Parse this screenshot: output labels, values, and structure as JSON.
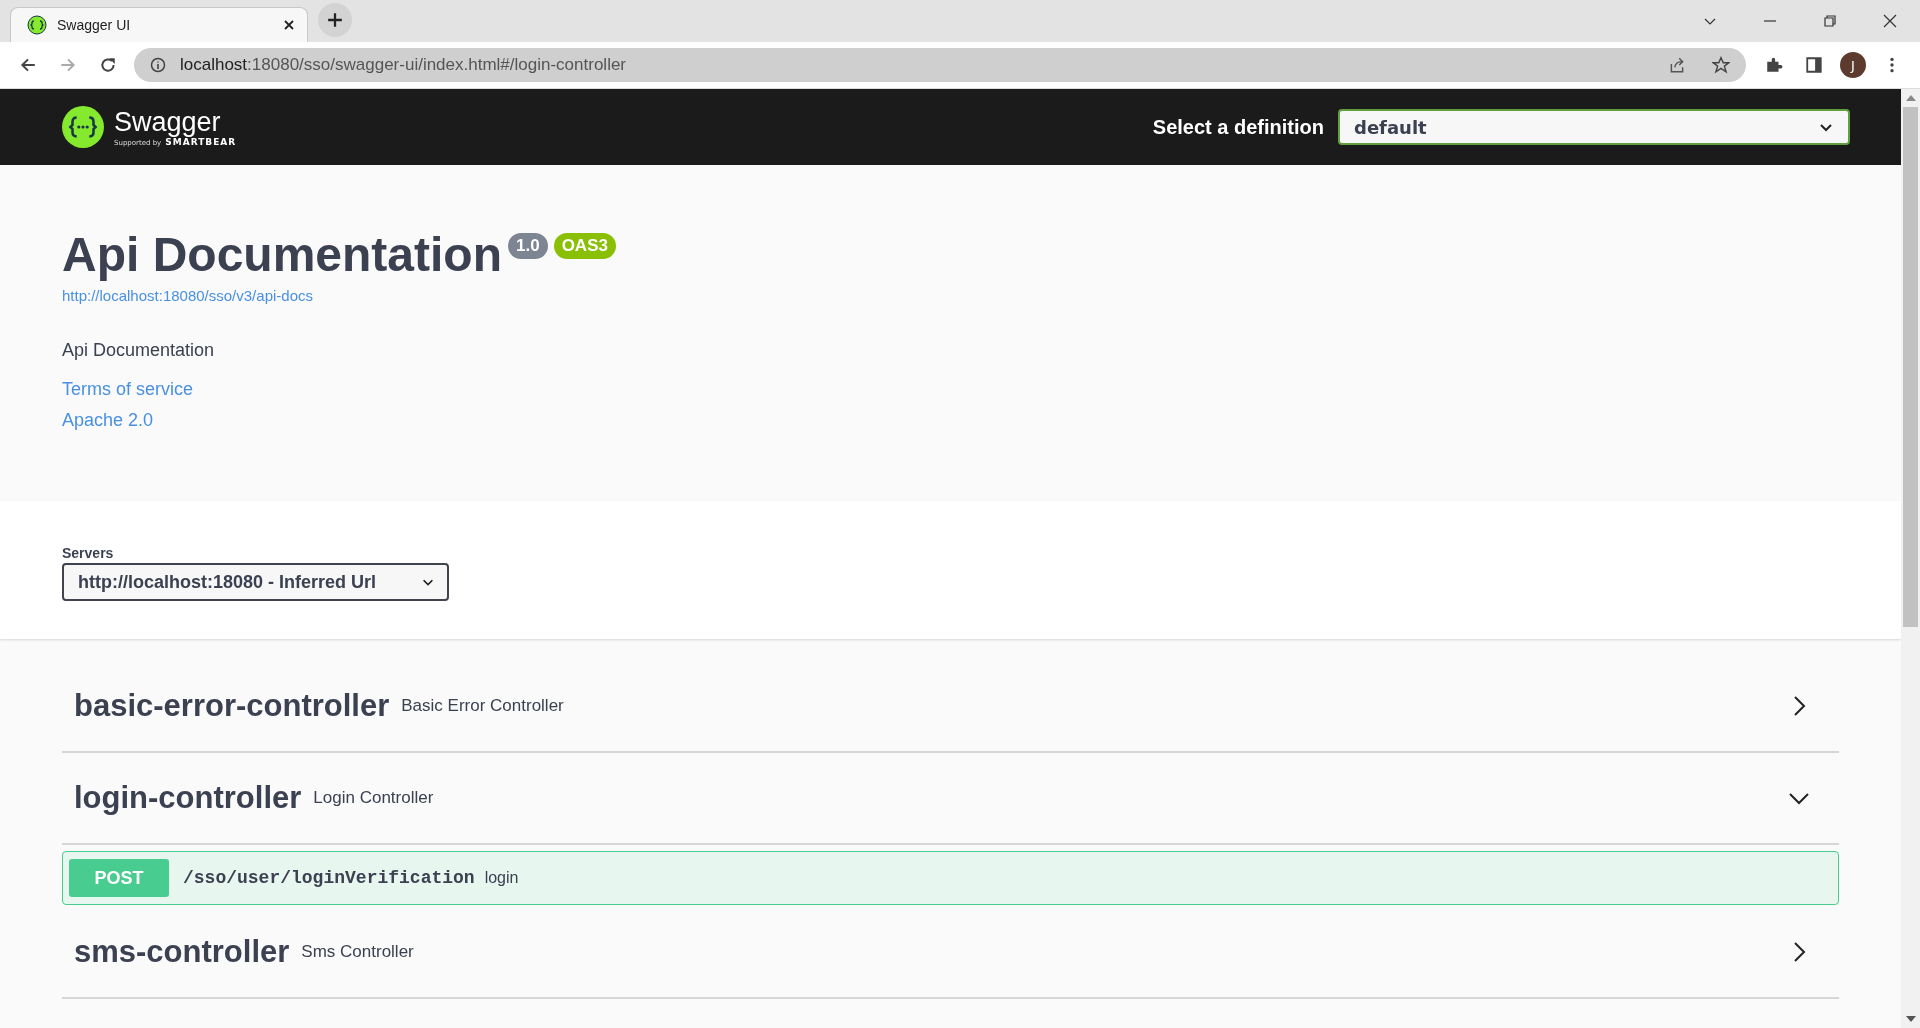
{
  "browser": {
    "tab_title": "Swagger UI",
    "url_host": "localhost",
    "url_rest": ":18080/sso/swagger-ui/index.html#/login-controller",
    "profile_initial": "J"
  },
  "topbar": {
    "logo_text": "Swagger",
    "logo_sub": "Supported by",
    "logo_brand": "SMARTBEAR",
    "definition_label": "Select a definition",
    "definition_value": "default"
  },
  "info": {
    "title": "Api Documentation",
    "version": "1.0",
    "spec": "OAS3",
    "spec_url": "http://localhost:18080/sso/v3/api-docs",
    "description": "Api Documentation",
    "links": [
      "Terms of service",
      "Apache 2.0"
    ]
  },
  "servers": {
    "label": "Servers",
    "value": "http://localhost:18080 - Inferred Url"
  },
  "tags": [
    {
      "name": "basic-error-controller",
      "description": "Basic Error Controller",
      "expanded": false
    },
    {
      "name": "login-controller",
      "description": "Login Controller",
      "expanded": true,
      "operations": [
        {
          "method": "POST",
          "path": "/sso/user/loginVerification",
          "summary": "login"
        }
      ]
    },
    {
      "name": "sms-controller",
      "description": "Sms Controller",
      "expanded": false
    }
  ]
}
